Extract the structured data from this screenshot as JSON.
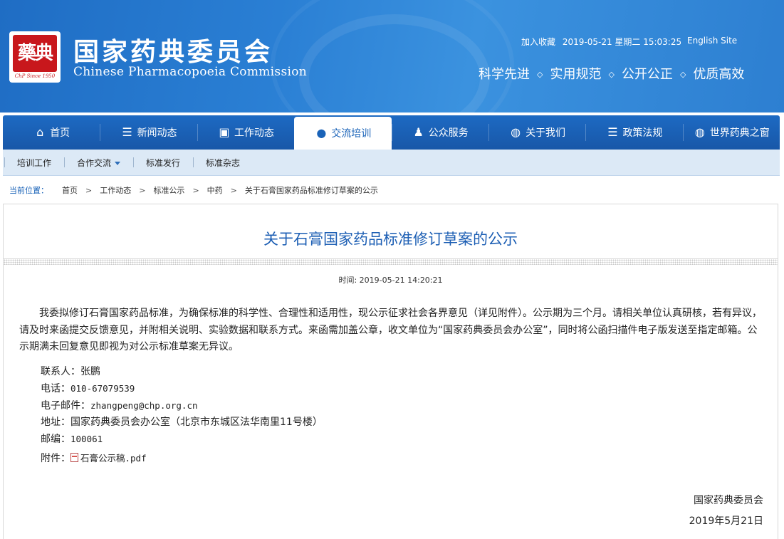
{
  "header": {
    "logo_since": "ChP Since 1950",
    "title_cn": "国家药典委员会",
    "title_en": "Chinese Pharmacopoeia Commission",
    "bookmark": "加入收藏",
    "datetime": "2019-05-21 星期二 15:03:25",
    "english_site": "English Site",
    "slogans": [
      "科学先进",
      "实用规范",
      "公开公正",
      "优质高效"
    ],
    "slogan_separator": "◇"
  },
  "nav": {
    "items": [
      {
        "label": "首页",
        "icon": "home-icon"
      },
      {
        "label": "新闻动态",
        "icon": "list-icon"
      },
      {
        "label": "工作动态",
        "icon": "briefcase-icon"
      },
      {
        "label": "交流培训",
        "icon": "chat-icon",
        "active": true
      },
      {
        "label": "公众服务",
        "icon": "users-icon"
      },
      {
        "label": "关于我们",
        "icon": "globe-icon"
      },
      {
        "label": "政策法规",
        "icon": "list-icon"
      },
      {
        "label": "世界药典之窗",
        "icon": "globe-icon"
      }
    ]
  },
  "subnav": {
    "items": [
      "培训工作",
      "合作交流",
      "标准发行",
      "标准杂志"
    ]
  },
  "breadcrumb": {
    "label": "当前位置：",
    "items": [
      "首页",
      "工作动态",
      "标准公示",
      "中药",
      "关于石膏国家药品标准修订草案的公示"
    ],
    "separator": ">"
  },
  "article": {
    "title": "关于石膏国家药品标准修订草案的公示",
    "time": "时间: 2019-05-21 14:20:21",
    "body": "我委拟修订石膏国家药品标准，为确保标准的科学性、合理性和适用性，现公示征求社会各界意见（详见附件）。公示期为三个月。请相关单位认真研核，若有异议，请及时来函提交反馈意见，并附相关说明、实验数据和联系方式。来函需加盖公章，收文单位为“国家药典委员会办公室”，同时将公函扫描件电子版发送至指定邮箱。公示期满未回复意见即视为对公示标准草案无异议。",
    "contact_label": "联系人：",
    "contact": "张鹏",
    "phone_label": "电话：",
    "phone": "010-67079539",
    "email_label": "电子邮件：",
    "email": "zhangpeng@chp.org.cn",
    "address_label": "地址：",
    "address": "国家药典委员会办公室（北京市东城区法华南里11号楼）",
    "zip_label": "邮编：",
    "zip": "100061",
    "attachment_label": "附件：",
    "attachment": "石膏公示稿.pdf",
    "signature": "国家药典委员会",
    "date": "2019年5月21日"
  },
  "colors": {
    "header_blue": "#2a7fd4",
    "nav_blue": "#1d6ac3",
    "title_blue": "#1d5fb4",
    "seal_red": "#c8171c"
  }
}
